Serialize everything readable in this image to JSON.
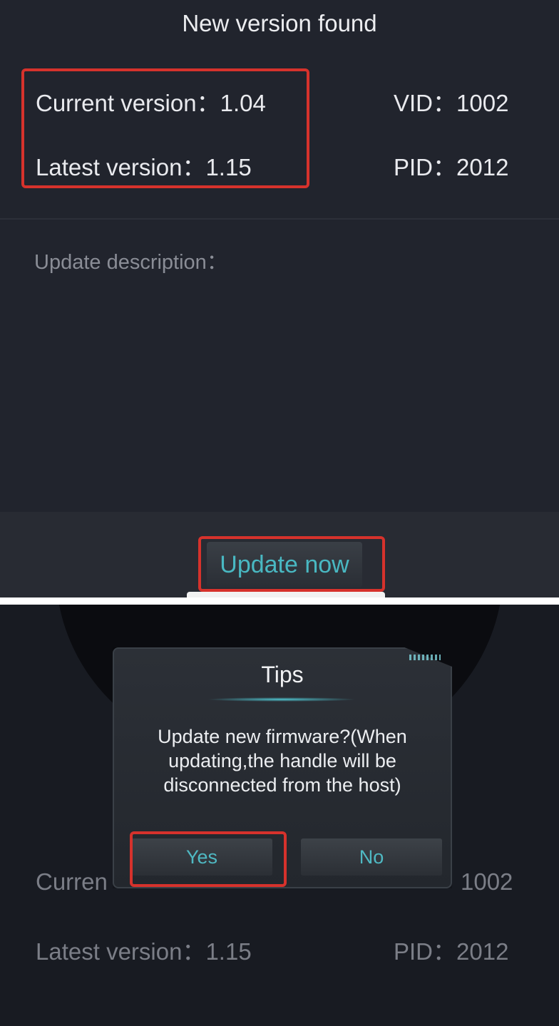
{
  "top": {
    "title": "New version found",
    "current_version": "Current version：1.04",
    "latest_version": "Latest version：1.15",
    "vid": "VID：1002",
    "pid": "PID：2012",
    "description_label": "Update description：",
    "update_button": "Update now"
  },
  "bottom": {
    "dialog": {
      "title": "Tips",
      "message": "Update new firmware?(When updating,the handle will be disconnected from the host)",
      "yes": "Yes",
      "no": "No"
    },
    "current_partial": "Curren",
    "vid_partial": "1002",
    "latest_version": "Latest version：1.15",
    "pid": "PID：2012"
  },
  "colors": {
    "background": "#21242d",
    "highlight": "#d6322c",
    "accent": "#49b8c2"
  }
}
